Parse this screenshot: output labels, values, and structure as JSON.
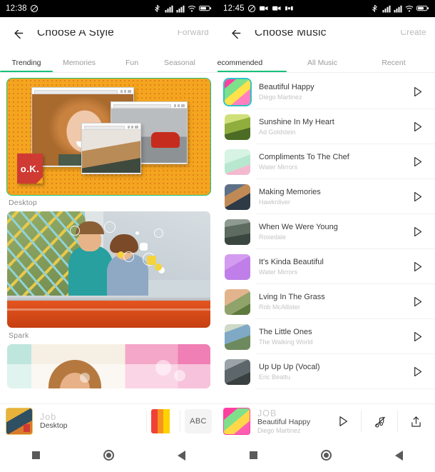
{
  "left_panel": {
    "status_bar": {
      "time": "12:38",
      "icons_left": [
        "mute-icon"
      ],
      "icons_right": [
        "bluetooth-icon",
        "signal-icon",
        "signal-icon",
        "wifi-icon",
        "battery-icon"
      ]
    },
    "app_bar": {
      "back_icon": "back-arrow-icon",
      "title": "Choose A Style",
      "action_label": "Forward"
    },
    "tabs": [
      {
        "label": "Trending",
        "active": true
      },
      {
        "label": "Memories",
        "active": false
      },
      {
        "label": "Fun",
        "active": false
      },
      {
        "label": "Seasonal",
        "active": false
      }
    ],
    "styles": [
      {
        "label": "Desktop",
        "selected": true
      },
      {
        "label": "Spark",
        "selected": false
      },
      {
        "label": "",
        "selected": false
      }
    ],
    "bottom_bar": {
      "job_label": "Job",
      "project_label": "Desktop",
      "color_swatch": [
        "#ef4136",
        "#f7941e",
        "#ffd200",
        "#ffffff"
      ],
      "text_button_label": "ABC",
      "text_button_icon": "text-style-icon"
    }
  },
  "right_panel": {
    "status_bar": {
      "time": "12:45",
      "icons_left": [
        "mute-icon",
        "video-record-icon",
        "video-record-icon",
        "screen-record-icon"
      ],
      "icons_right": [
        "bluetooth-icon",
        "signal-icon",
        "signal-icon",
        "wifi-icon",
        "battery-icon"
      ]
    },
    "app_bar": {
      "back_icon": "back-arrow-icon",
      "title": "Choose Music",
      "action_label": "Create"
    },
    "tabs": [
      {
        "label": "Recommended",
        "active": true
      },
      {
        "label": "All Music",
        "active": false
      },
      {
        "label": "Recent",
        "active": false
      }
    ],
    "tracks": [
      {
        "title": "Beautiful Happy",
        "artist": "Diego Martinez",
        "selected": true,
        "art": "t-floral"
      },
      {
        "title": "Sunshine In My Heart",
        "artist": "Ad Goldstein",
        "selected": false,
        "art": "t-meadow"
      },
      {
        "title": "Compliments To The Chef",
        "artist": "Water Mirrors",
        "selected": false,
        "art": "t-mint"
      },
      {
        "title": "Making Memories",
        "artist": "Hawknliver",
        "selected": false,
        "art": "t-photo"
      },
      {
        "title": "When We Were Young",
        "artist": "Rosedale",
        "selected": false,
        "art": "t-forest"
      },
      {
        "title": "It's Kinda Beautiful",
        "artist": "Water Mirrors",
        "selected": false,
        "art": "t-violet"
      },
      {
        "title": "Lving In The Grass",
        "artist": "Rob McAllister",
        "selected": false,
        "art": "t-grass"
      },
      {
        "title": "The Little Ones",
        "artist": "The Walking World",
        "selected": false,
        "art": "t-door"
      },
      {
        "title": "Up Up Up (Vocal)",
        "artist": "Eric Beattu",
        "selected": false,
        "art": "t-road"
      }
    ],
    "bottom_bar": {
      "job_label": "JOB",
      "track_title": "Beautiful Happy",
      "track_artist": "Diego Martinez",
      "play_icon": "play-icon",
      "mute_music_icon": "music-off-icon",
      "share_icon": "share-upload-icon"
    }
  },
  "nav_bar": {
    "recents_icon": "recents-square-icon",
    "home_icon": "home-circle-icon",
    "back_icon": "back-triangle-icon"
  },
  "colors": {
    "accent_green": "#18c07a",
    "selection_teal": "#2fc4c4",
    "status_bar_bg": "#000000"
  }
}
